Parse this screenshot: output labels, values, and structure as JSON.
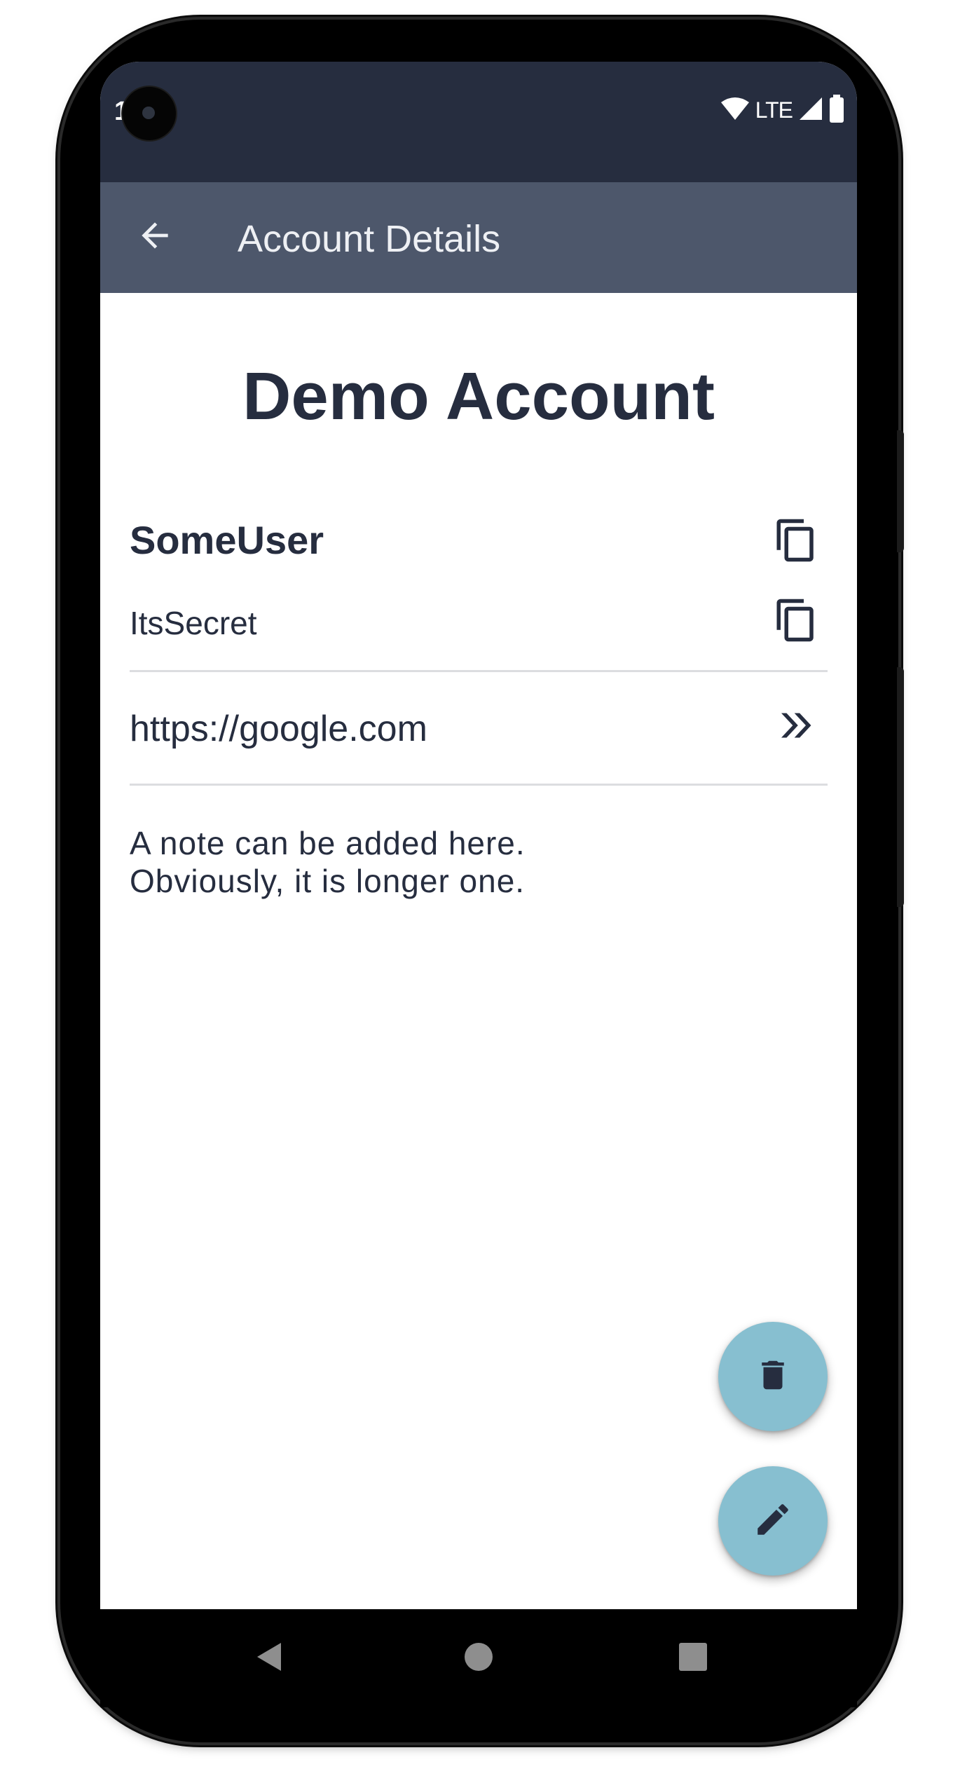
{
  "status_bar": {
    "time": "1 0",
    "network_label": "LTE",
    "icons": [
      "wifi-icon",
      "cell-signal-icon",
      "battery-icon"
    ]
  },
  "app_bar": {
    "title": "Account Details",
    "back_icon": "arrow-back-icon"
  },
  "account": {
    "name": "Demo Account",
    "username": "SomeUser",
    "password": "ItsSecret",
    "url": "https://google.com",
    "notes": [
      "A note can be added here.",
      "Obviously, it is longer one."
    ]
  },
  "icons": {
    "copy_username": "copy-icon",
    "copy_password": "copy-icon",
    "open_url": "double-chevron-right-icon",
    "delete": "trash-icon",
    "edit": "pencil-icon"
  },
  "navigation": [
    "nav-back-icon",
    "nav-home-icon",
    "nav-recents-icon"
  ],
  "colors": {
    "status_bar": "#262d3f",
    "app_bar": "#4d576b",
    "text_primary": "#262d3f",
    "fab": "#87bfd0",
    "divider": "#dcdde0"
  }
}
